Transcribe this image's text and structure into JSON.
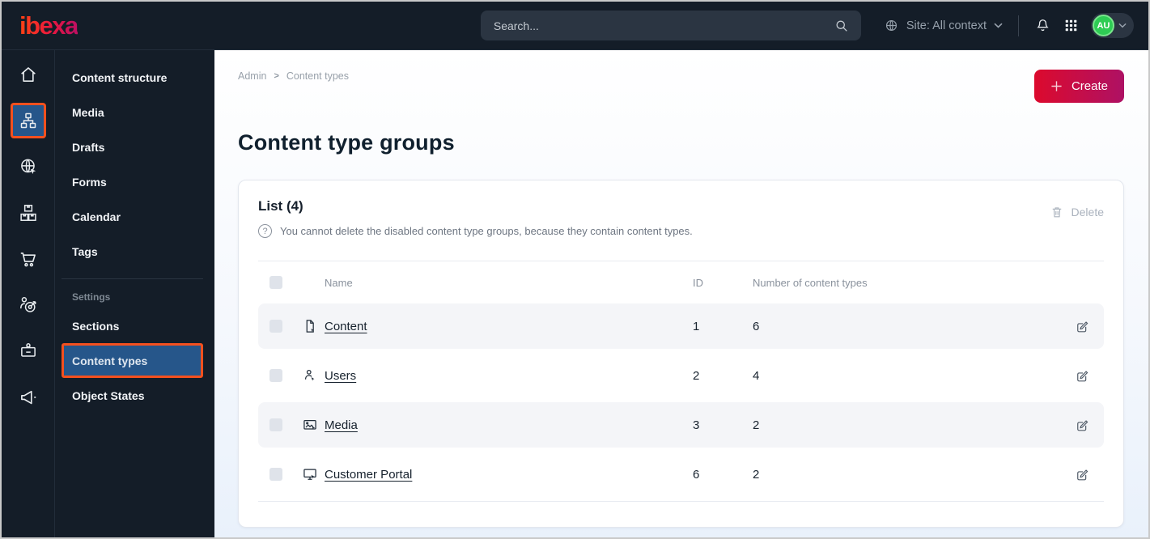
{
  "colors": {
    "topbar_bg": "#141d28",
    "accent_orange": "#f4501e",
    "active_blue": "#26568a",
    "create_gradient_start": "#dc0a2d",
    "create_gradient_end": "#ae1164",
    "avatar_green": "#2ecc54",
    "row_alt_bg": "#f4f5f8"
  },
  "topbar": {
    "logo_text": "ibexa",
    "search_placeholder": "Search...",
    "site_context_label": "Site: All context",
    "avatar_initials": "AU"
  },
  "rail": {
    "items": [
      {
        "icon": "home-icon",
        "label": "dashboard",
        "active": false
      },
      {
        "icon": "sitemap-icon",
        "label": "content",
        "active": true
      },
      {
        "icon": "site-globe-icon",
        "label": "site",
        "active": false
      },
      {
        "icon": "products-icon",
        "label": "products",
        "active": false
      },
      {
        "icon": "cart-icon",
        "label": "commerce",
        "active": false
      },
      {
        "icon": "personalization-icon",
        "label": "personalization",
        "active": false
      },
      {
        "icon": "admin-badge-icon",
        "label": "admin",
        "active": false
      },
      {
        "icon": "megaphone-icon",
        "label": "marketing",
        "active": false
      }
    ]
  },
  "sidebar": {
    "items": [
      "Content structure",
      "Media",
      "Drafts",
      "Forms",
      "Calendar",
      "Tags"
    ],
    "settings_label": "Settings",
    "settings_items": [
      "Sections",
      "Content types",
      "Object States"
    ],
    "active_item": "Content types"
  },
  "breadcrumb": {
    "root": "Admin",
    "separator": ">",
    "current": "Content types"
  },
  "page": {
    "title": "Content type groups",
    "create_button_label": "Create"
  },
  "card": {
    "title": "List (4)",
    "help_glyph": "?",
    "info_text": "You cannot delete the disabled content type groups, because they contain content types.",
    "delete_button_label": "Delete",
    "table": {
      "headers": {
        "name": "Name",
        "id": "ID",
        "count": "Number of content types"
      },
      "rows": [
        {
          "icon": "file-icon",
          "name": "Content",
          "id": "1",
          "count": "6"
        },
        {
          "icon": "user-icon",
          "name": "Users",
          "id": "2",
          "count": "4"
        },
        {
          "icon": "image-icon",
          "name": "Media",
          "id": "3",
          "count": "2"
        },
        {
          "icon": "monitor-icon",
          "name": "Customer Portal",
          "id": "6",
          "count": "2"
        }
      ]
    }
  }
}
